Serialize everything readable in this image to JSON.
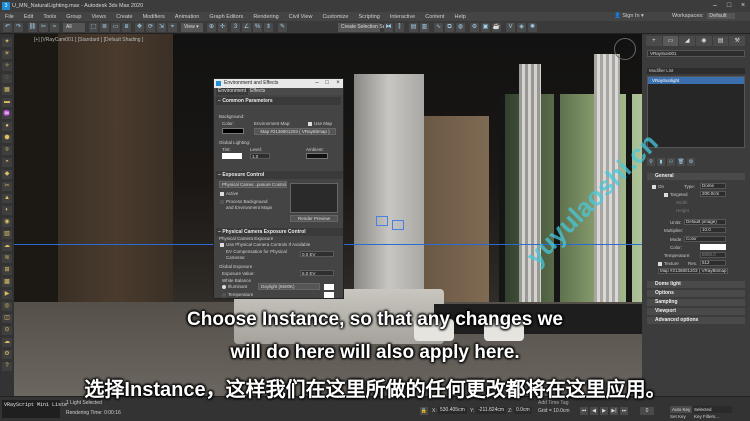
{
  "app": {
    "title": "U_MN_NaturalLighting.max - Autodesk 3ds Max 2020",
    "sign_in": "Sign In",
    "workspaces_label": "Workspaces:",
    "workspace_value": "Default"
  },
  "menu": [
    "File",
    "Edit",
    "Tools",
    "Group",
    "Views",
    "Create",
    "Modifiers",
    "Animation",
    "Graph Editors",
    "Rendering",
    "Civil View",
    "Customize",
    "Scripting",
    "Interactive",
    "Content",
    "Help"
  ],
  "toolbar": {
    "filter_value": "All",
    "selection_set": "Create Selection Se"
  },
  "viewport": {
    "label": "[+] [VRayCam001 ] [Standard ] [Default Shading ]"
  },
  "dialog": {
    "title": "Environment and Effects",
    "tabs": [
      "Environment",
      "Effects"
    ],
    "common_params": "Common Parameters",
    "background": "Background:",
    "color": "Color:",
    "env_map": "Environment Map:",
    "use_map": "Use Map",
    "map_name": "Map #2136801203 ( VRayBitmap )",
    "global_lighting": "Global Lighting:",
    "tint": "Tint:",
    "level": "Level:",
    "level_value": "1.0",
    "ambient": "Ambient:",
    "exposure_control": "Exposure Control",
    "exposure_value": "Physical Camer...posure Control",
    "active": "Active",
    "process_bg_1": "Process Background",
    "process_bg_2": "and Environment Maps",
    "render_preview": "Render Preview",
    "phys_cam_exposure_control": "Physical Camera Exposure Control",
    "phys_cam_exposure": "Physical Camera Exposure",
    "use_phys_cam": "Use Physical Camera Controls If Available",
    "ev_comp_1": "EV Compensation for Physical",
    "ev_comp_2": "Cameras:",
    "ev_comp_value": "0.0 EV",
    "global_exposure": "Global Exposure",
    "exposure_label": "Exposure Value:",
    "exposure_ev": "6.0 EV",
    "white_balance": "White Balance",
    "illuminant": "Illuminant",
    "illuminant_value": "Daylight (6500K)",
    "temperature": "Temperature"
  },
  "cmdpanel": {
    "tabs": [
      "+",
      "▭",
      "◢",
      "◉",
      "▤",
      "⚒"
    ],
    "object_name": "VRaySun001",
    "modifier_list": "Modifier List",
    "stack_item": "VRaySunlight",
    "general": "General",
    "on": "On",
    "type_label": "Type:",
    "type_value": "Dome",
    "targeted": "Targeted",
    "length_value": "200.0cm",
    "width_label": "Width",
    "height_label": "Height",
    "units_label": "Units:",
    "units_value": "Default (image)",
    "multiplier_label": "Multiplier:",
    "multiplier_value": "10.0",
    "mode_label": "Mode:",
    "mode_value": "Color",
    "color_label": "Color:",
    "temperature_label": "Temperature:",
    "temperature_value": "6500.0",
    "texture_label": "Texture",
    "res_label": "Res.",
    "res_value": "512",
    "map_value": "Map #2136801203 ( VRayBitmap )",
    "sections": [
      "Dome light",
      "Options",
      "Sampling",
      "Viewport",
      "Advanced options"
    ]
  },
  "status": {
    "script": "VRayScript Mini Liste",
    "selected": "1 Light Selected",
    "rendering_time": "Rendering Time: 0:00:16",
    "x_label": "X:",
    "x_value": "530.405cm",
    "y_label": "Y:",
    "y_value": "-211.824cm",
    "z_label": "Z:",
    "z_value": "0.0cm",
    "grid": "Grid = 10.0cm",
    "add_time_tag": "Add Time Tag",
    "auto_key": "Auto Key",
    "selected_label": "Selected",
    "set_key": "Set Key",
    "key_filters": "Key Filters..."
  },
  "subtitles": {
    "line1": "Choose Instance, so that any changes we",
    "line2": "will do here will also apply here.",
    "line3": "选择Instance，这样我们在这里所做的任何更改都将在这里应用。"
  },
  "watermark": "yuyulaoshi.cn",
  "colors": {
    "accent": "#3b6fae",
    "selection_blue": "#2b6cd4",
    "watermark": "#46c8dc"
  }
}
